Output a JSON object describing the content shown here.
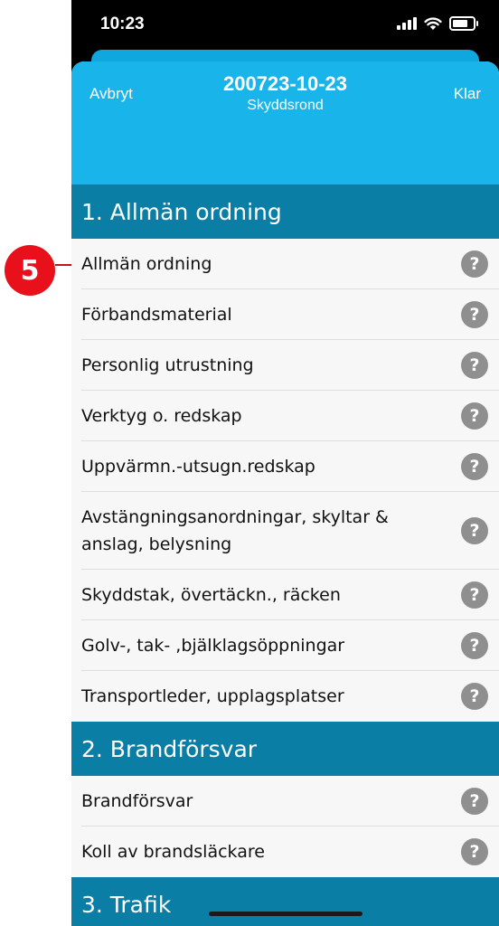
{
  "annotation": {
    "number": "5"
  },
  "status_bar": {
    "time": "10:23"
  },
  "nav": {
    "cancel": "Avbryt",
    "done": "Klar",
    "title": "200723-10-23",
    "subtitle": "Skyddsrond"
  },
  "sections": [
    {
      "title": "1. Allmän ordning",
      "items": [
        {
          "label": "Allmän ordning"
        },
        {
          "label": "Förbandsmaterial"
        },
        {
          "label": "Personlig utrustning"
        },
        {
          "label": "Verktyg o. redskap"
        },
        {
          "label": "Uppvärmn.-utsugn.redskap"
        },
        {
          "label": "Avstängningsanordningar, skyltar & anslag, belysning"
        },
        {
          "label": "Skyddstak, övertäckn., räcken"
        },
        {
          "label": "Golv-, tak- ,bjälklagsöppningar"
        },
        {
          "label": "Transportleder, upplagsplatser"
        }
      ]
    },
    {
      "title": "2. Brandförsvar",
      "items": [
        {
          "label": "Brandförsvar"
        },
        {
          "label": "Koll av brandsläckare"
        }
      ]
    },
    {
      "title": "3. Trafik",
      "items": []
    }
  ],
  "help_icon_glyph": "?",
  "colors": {
    "header_bg": "#19b4ea",
    "section_bg": "#0b7ea5",
    "callout": "#e8101a",
    "help_icon": "#8f8f8f"
  }
}
